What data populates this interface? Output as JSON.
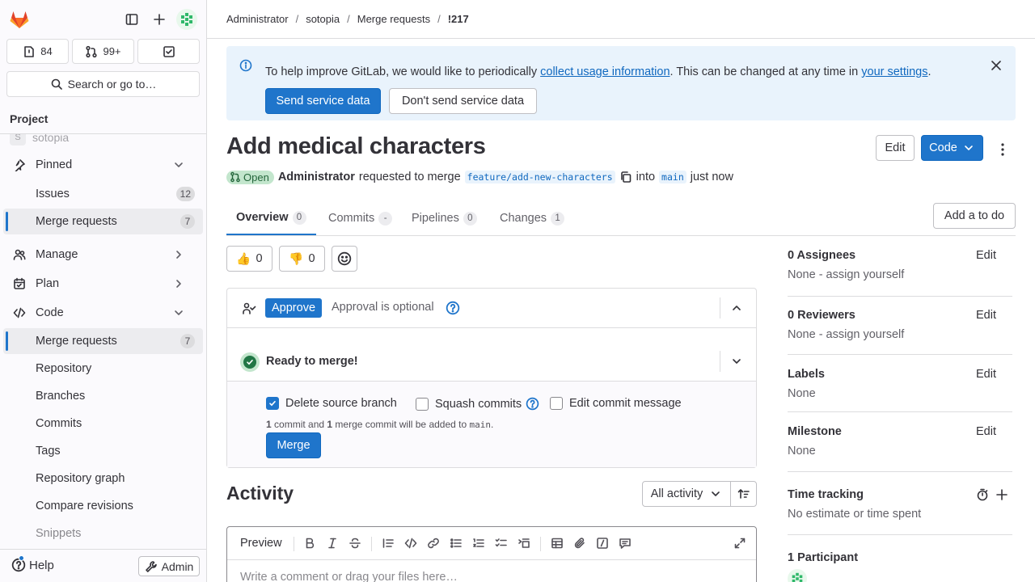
{
  "sidebar": {
    "counters": {
      "issues": "84",
      "merge_requests": "99+"
    },
    "search_label": "Search or go to…",
    "section_title": "Project",
    "project_ghost": {
      "initial": "S",
      "name": "sotopia"
    },
    "items": [
      {
        "label": "Pinned"
      },
      {
        "label": "Issues",
        "badge": "12"
      },
      {
        "label": "Merge requests",
        "badge": "7"
      },
      {
        "label": "Manage"
      },
      {
        "label": "Plan"
      },
      {
        "label": "Code"
      },
      {
        "label": "Merge requests",
        "badge": "7"
      },
      {
        "label": "Repository"
      },
      {
        "label": "Branches"
      },
      {
        "label": "Commits"
      },
      {
        "label": "Tags"
      },
      {
        "label": "Repository graph"
      },
      {
        "label": "Compare revisions"
      },
      {
        "label": "Snippets"
      }
    ],
    "help_label": "Help",
    "admin_label": "Admin"
  },
  "breadcrumb": [
    "Administrator",
    "sotopia",
    "Merge requests",
    "!217"
  ],
  "banner": {
    "text_before": "To help improve GitLab, we would like to periodically ",
    "link1": "collect usage information",
    "text_middle": ". This can be changed at any time in ",
    "link2": "your settings",
    "text_after": ".",
    "send_button": "Send service data",
    "dont_send_button": "Don't send service data"
  },
  "mr": {
    "title": "Add medical characters",
    "status": "Open",
    "author": "Administrator",
    "requested_text": "requested to merge",
    "source_branch": "feature/add-new-characters",
    "into_text": "into",
    "target_branch": "main",
    "time": "just now",
    "edit_button": "Edit",
    "code_button": "Code"
  },
  "tabs": [
    {
      "label": "Overview",
      "count": "0"
    },
    {
      "label": "Commits",
      "count": "-"
    },
    {
      "label": "Pipelines",
      "count": "0"
    },
    {
      "label": "Changes",
      "count": "1"
    }
  ],
  "add_todo": "Add a to do",
  "reactions": {
    "thumbs_up": "👍",
    "thumbs_up_count": "0",
    "thumbs_down": "👎",
    "thumbs_down_count": "0"
  },
  "approval": {
    "button": "Approve",
    "text": "Approval is optional"
  },
  "merge": {
    "title": "Ready to merge!",
    "delete_source": "Delete source branch",
    "squash": "Squash commits",
    "edit_message": "Edit commit message",
    "info_n1": "1",
    "info_a": " commit and ",
    "info_n2": "1",
    "info_b": " merge commit will be added to ",
    "info_branch": "main",
    "info_c": ".",
    "merge_button": "Merge"
  },
  "activity": {
    "title": "Activity",
    "filter": "All activity",
    "preview_tab": "Preview",
    "placeholder": "Write a comment or drag your files here…"
  },
  "right_sidebar": {
    "assignees": {
      "title": "0 Assignees",
      "value": "None - assign yourself",
      "edit": "Edit"
    },
    "reviewers": {
      "title": "0 Reviewers",
      "value": "None - assign yourself",
      "edit": "Edit"
    },
    "labels": {
      "title": "Labels",
      "value": "None",
      "edit": "Edit"
    },
    "milestone": {
      "title": "Milestone",
      "value": "None",
      "edit": "Edit"
    },
    "time_tracking": {
      "title": "Time tracking",
      "value": "No estimate or time spent"
    },
    "participants": {
      "title": "1 Participant"
    }
  },
  "colors": {
    "accent": "#1f75cb",
    "success": "#217645",
    "sidebar_bg": "#fbfafd",
    "banner_bg": "#e9f3fc"
  }
}
